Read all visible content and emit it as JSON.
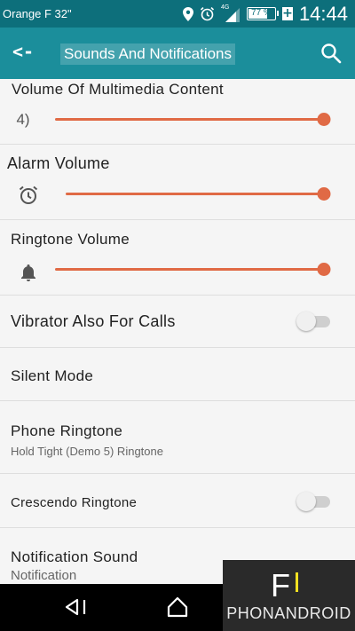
{
  "status_bar": {
    "carrier": "Orange F 32\"",
    "network": "4G",
    "battery": "77 %",
    "battery_level": 0.77,
    "charging_symbol": "+",
    "time": "14:44",
    "icons": [
      "location-icon",
      "alarm-icon",
      "signal-icon",
      "battery-icon"
    ]
  },
  "action_bar": {
    "back_glyph": "<-",
    "title": "Sounds And Notifications",
    "icons": [
      "back-arrow-icon",
      "search-icon"
    ]
  },
  "settings": {
    "multimedia": {
      "label": "Volume Of Multimedia Content",
      "icon": "speaker-icon",
      "icon_text": "4)",
      "level": 1.0
    },
    "alarm": {
      "label": "Alarm Volume",
      "icon": "alarm-clock-icon",
      "level": 1.0
    },
    "ringtone_volume": {
      "label": "Ringtone Volume",
      "icon": "bell-icon",
      "level": 1.0
    },
    "vibrate": {
      "label": "Vibrator Also For Calls",
      "enabled": false
    },
    "silent": {
      "label": "Silent Mode"
    },
    "phone_ringtone": {
      "label": "Phone Ringtone",
      "value": "Hold Tight (Demo 5) Ringtone"
    },
    "crescendo": {
      "label": "Crescendo Ringtone",
      "enabled": false
    },
    "notification_sound": {
      "label": "Notification Sound",
      "value": "Notification"
    }
  },
  "nav_bar": {
    "icons": [
      "back-icon",
      "home-icon"
    ]
  },
  "watermark": {
    "logo": "phonandroid-logo",
    "logo_letter": "F",
    "text": "PHONANDROID"
  },
  "colors": {
    "status_bar": "#0d6f7b",
    "action_bar": "#1b8e9b",
    "accent": "#e06a45",
    "background": "#f5f5f5"
  }
}
